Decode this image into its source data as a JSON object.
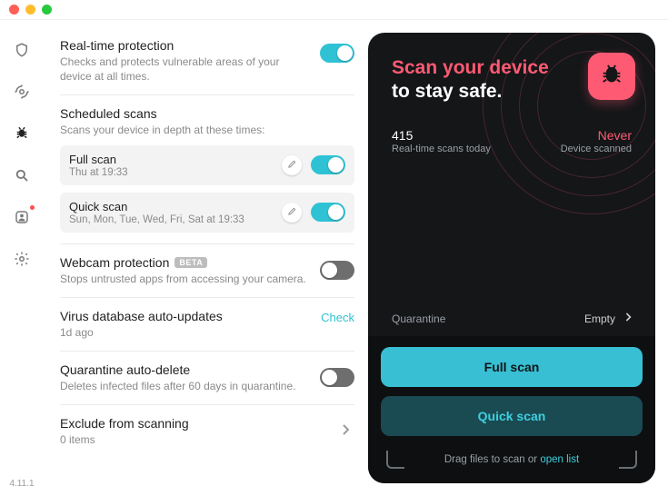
{
  "window": {
    "version": "4.11.1"
  },
  "colors": {
    "accent_teal": "#2fc2d4",
    "accent_pink": "#ff5a73"
  },
  "sidebar": {
    "items": [
      {
        "name": "shield-icon",
        "active": false,
        "alert": false
      },
      {
        "name": "radar-icon",
        "active": false,
        "alert": false
      },
      {
        "name": "bug-icon",
        "active": true,
        "alert": false
      },
      {
        "name": "search-icon",
        "active": false,
        "alert": false
      },
      {
        "name": "person-icon",
        "active": false,
        "alert": true
      },
      {
        "name": "gear-icon",
        "active": false,
        "alert": false
      }
    ]
  },
  "settings": {
    "realtime": {
      "title": "Real-time protection",
      "sub": "Checks and protects vulnerable areas of your device at all times.",
      "on": true
    },
    "scheduled": {
      "title": "Scheduled scans",
      "sub": "Scans your device in depth at these times:",
      "scans": [
        {
          "title": "Full scan",
          "sub": "Thu at 19:33",
          "on": true
        },
        {
          "title": "Quick scan",
          "sub": "Sun, Mon, Tue, Wed, Fri, Sat at 19:33",
          "on": true
        }
      ]
    },
    "webcam": {
      "title": "Webcam protection",
      "badge": "BETA",
      "sub": "Stops untrusted apps from accessing your camera.",
      "on": false
    },
    "db_update": {
      "title": "Virus database auto-updates",
      "sub": "1d ago",
      "action_label": "Check"
    },
    "quarantine_auto": {
      "title": "Quarantine auto-delete",
      "sub": "Deletes infected files after 60 days in quarantine.",
      "on": false
    },
    "exclude": {
      "title": "Exclude from scanning",
      "sub": "0 items"
    }
  },
  "panel": {
    "headline_accent": "Scan your device",
    "headline_rest": "to stay safe.",
    "stats": {
      "scans_value": "415",
      "scans_label": "Real-time scans today",
      "scanned_value": "Never",
      "scanned_label": "Device scanned"
    },
    "quarantine": {
      "label": "Quarantine",
      "value": "Empty"
    },
    "full_scan_label": "Full scan",
    "quick_scan_label": "Quick scan",
    "drop_prefix": "Drag files to scan or ",
    "drop_link": "open list"
  }
}
